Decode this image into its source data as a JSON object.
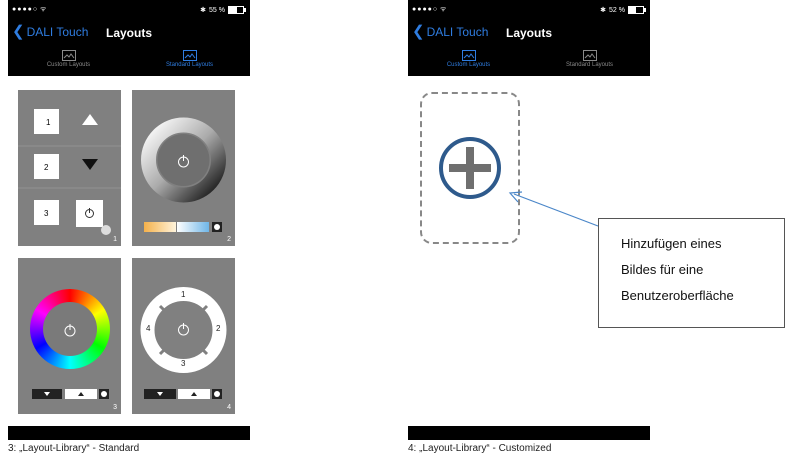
{
  "left_phone": {
    "status": {
      "signal": "●●●●○",
      "wifi": "ᯤ",
      "bt": "✱",
      "battery": "55 %",
      "battery_level": 0.55
    },
    "nav": {
      "back_label": "DALI Touch",
      "title": "Layouts"
    },
    "tabs": [
      {
        "label": "Custom Layouts",
        "active": false
      },
      {
        "label": "Standard Layouts",
        "active": true
      }
    ],
    "tiles": [
      {
        "number": "1",
        "buttons": [
          "1",
          "2",
          "3"
        ]
      },
      {
        "number": "2"
      },
      {
        "number": "3"
      },
      {
        "number": "4",
        "ring_labels": [
          "1",
          "2",
          "3",
          "4"
        ]
      }
    ]
  },
  "right_phone": {
    "status": {
      "signal": "●●●●○",
      "wifi": "ᯤ",
      "bt": "✱",
      "battery": "52 %",
      "battery_level": 0.52
    },
    "nav": {
      "back_label": "DALI Touch",
      "title": "Layouts"
    },
    "tabs": [
      {
        "label": "Custom Layouts",
        "active": true
      },
      {
        "label": "Standard Layouts",
        "active": false
      }
    ]
  },
  "callout": {
    "lines": [
      "Hinzufügen eines",
      "Bildes für eine",
      "Benutzeroberfläche"
    ]
  },
  "captions": {
    "left": "3: „Layout-Library“ - Standard",
    "right": "4: „Layout-Library“ - Customized"
  },
  "colors": {
    "accent": "#2f7de1",
    "tile_bg": "#808080",
    "plus_ring": "#2e5a8c"
  },
  "icons": {
    "image_tab": "image-icon",
    "back": "chevron-left-icon",
    "power": "power-icon",
    "bulb": "bulb-icon",
    "add": "plus-icon"
  }
}
